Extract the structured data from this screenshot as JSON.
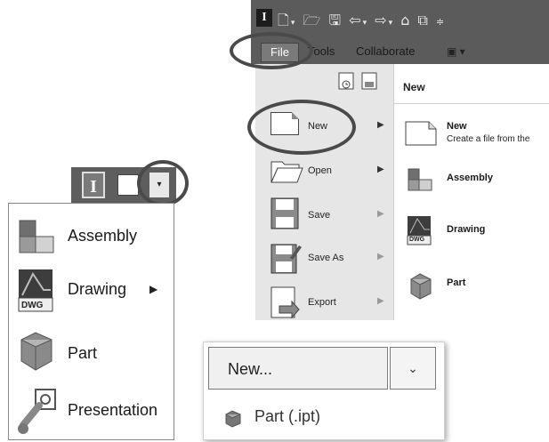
{
  "ribbon": {
    "tabs": [
      {
        "label": "File"
      },
      {
        "label": "Tools"
      },
      {
        "label": "Collaborate"
      }
    ],
    "extra_tab_glyph": "▣ ▾"
  },
  "file_menu": {
    "items": [
      {
        "label": "New",
        "has_submenu": true,
        "icon": "new-file-icon"
      },
      {
        "label": "Open",
        "has_submenu": true,
        "icon": "folder-open-icon"
      },
      {
        "label": "Save",
        "has_submenu": true,
        "icon": "save-icon"
      },
      {
        "label": "Save As",
        "has_submenu": true,
        "icon": "save-as-icon"
      },
      {
        "label": "Export",
        "has_submenu": true,
        "icon": "export-icon"
      }
    ],
    "submenu": {
      "header": "New",
      "items": [
        {
          "title": "New",
          "description": "Create a file from the",
          "icon": "new-file-icon"
        },
        {
          "title": "Assembly",
          "icon": "assembly-icon"
        },
        {
          "title": "Drawing",
          "icon": "drawing-icon",
          "icon_text": "DWG"
        },
        {
          "title": "Part",
          "icon": "part-icon"
        }
      ]
    }
  },
  "left_dropdown": {
    "logo_letter": "I",
    "items": [
      {
        "label": "Assembly",
        "icon": "assembly-icon"
      },
      {
        "label": "Drawing",
        "icon": "drawing-icon",
        "icon_text": "DWG",
        "has_submenu": true
      },
      {
        "label": "Part",
        "icon": "part-icon"
      },
      {
        "label": "Presentation",
        "icon": "presentation-icon"
      }
    ]
  },
  "combo": {
    "value": "New...",
    "options": [
      {
        "label": "Part (.ipt)",
        "icon": "part-icon"
      }
    ]
  },
  "colors": {
    "ribbon_dark": "#5b5b5b",
    "menu_bg": "#e6e6e6",
    "highlight_circle": "#4a4a4a"
  }
}
